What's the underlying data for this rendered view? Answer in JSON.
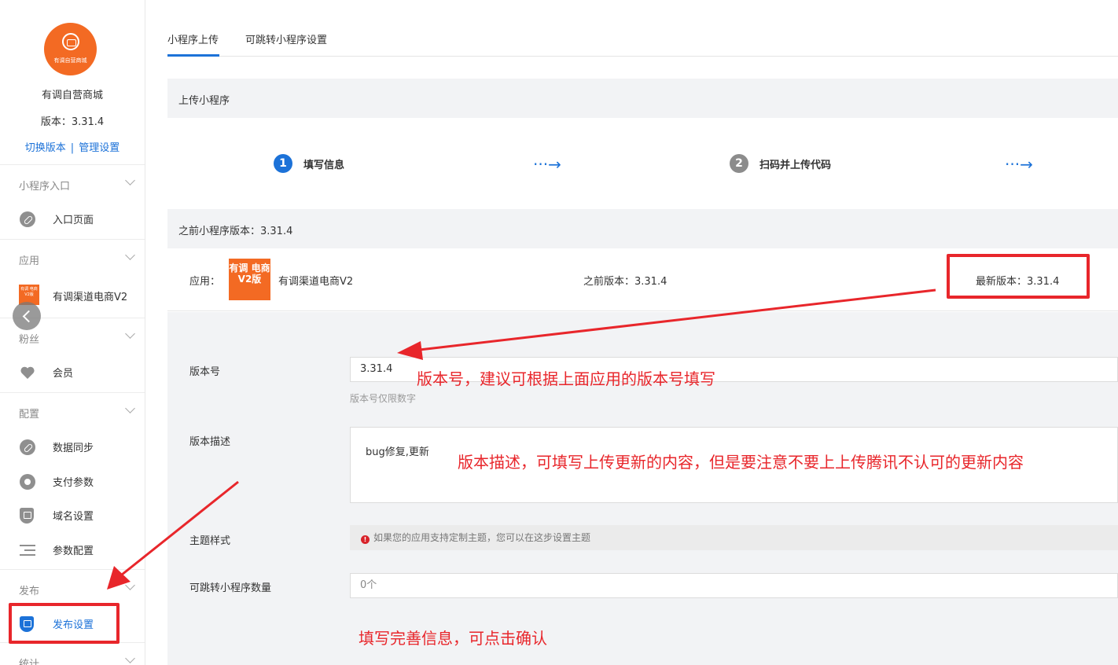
{
  "sidebar": {
    "logo_text": "有调自营商城",
    "store_name": "有调自营商城",
    "version": "版本：3.31.4",
    "link_switch": "切换版本",
    "link_separator": "|",
    "link_manage": "管理设置",
    "sections": [
      {
        "title": "小程序入口",
        "items": [
          {
            "label": "入口页面",
            "icon": "link-icon"
          }
        ]
      },
      {
        "title": "应用",
        "items": [
          {
            "label": "有调渠道电商V2",
            "icon": "app-thumbnail"
          }
        ]
      },
      {
        "title": "粉丝",
        "items": [
          {
            "label": "会员",
            "icon": "heart-icon"
          }
        ]
      },
      {
        "title": "配置",
        "items": [
          {
            "label": "数据同步",
            "icon": "link-icon"
          },
          {
            "label": "支付参数",
            "icon": "gear-icon"
          },
          {
            "label": "域名设置",
            "icon": "shield-icon"
          },
          {
            "label": "参数配置",
            "icon": "list-icon"
          }
        ]
      },
      {
        "title": "发布",
        "items": [
          {
            "label": "发布设置",
            "icon": "shield-icon",
            "active": true
          }
        ]
      },
      {
        "title": "统计",
        "items": []
      }
    ],
    "app_thumb_text": "有调 电商 V2版"
  },
  "tabs": [
    {
      "label": "小程序上传",
      "active": true
    },
    {
      "label": "可跳转小程序设置",
      "active": false
    }
  ],
  "upload": {
    "header": "上传小程序",
    "steps": [
      {
        "num": "1",
        "label": "填写信息",
        "color": "#1c72d8"
      },
      {
        "num": "2",
        "label": "扫码并上传代码",
        "color": "#8c8c8c"
      }
    ],
    "step_arrow": "···→"
  },
  "previous": {
    "header": "之前小程序版本：3.31.4",
    "app_label": "应用：",
    "app_logo_text": "有调 电商 V2版",
    "app_name": "有调渠道电商V2",
    "prev_version": "之前版本：3.31.4",
    "latest_version": "最新版本：3.31.4"
  },
  "form": {
    "version_label": "版本号",
    "version_value": "3.31.4",
    "version_hint": "版本号仅限数字",
    "desc_label": "版本描述",
    "desc_value": "bug修复,更新",
    "theme_label": "主题样式",
    "theme_notice": "如果您的应用支持定制主题，您可以在这步设置主题",
    "theme_notice_icon": "!",
    "jump_label": "可跳转小程序数量",
    "jump_value": "0个"
  },
  "annotations": {
    "version_note": "版本号，建议可根据上面应用的版本号填写",
    "desc_note": "版本描述，可填写上传更新的内容，但是要注意不要上上传腾讯不认可的更新内容",
    "confirm_note": "填写完善信息，可点击确认",
    "color": "#e8262b"
  },
  "colors": {
    "accent": "#1c72d8",
    "brand_orange": "#f36a23",
    "annotation_red": "#e8262b"
  }
}
